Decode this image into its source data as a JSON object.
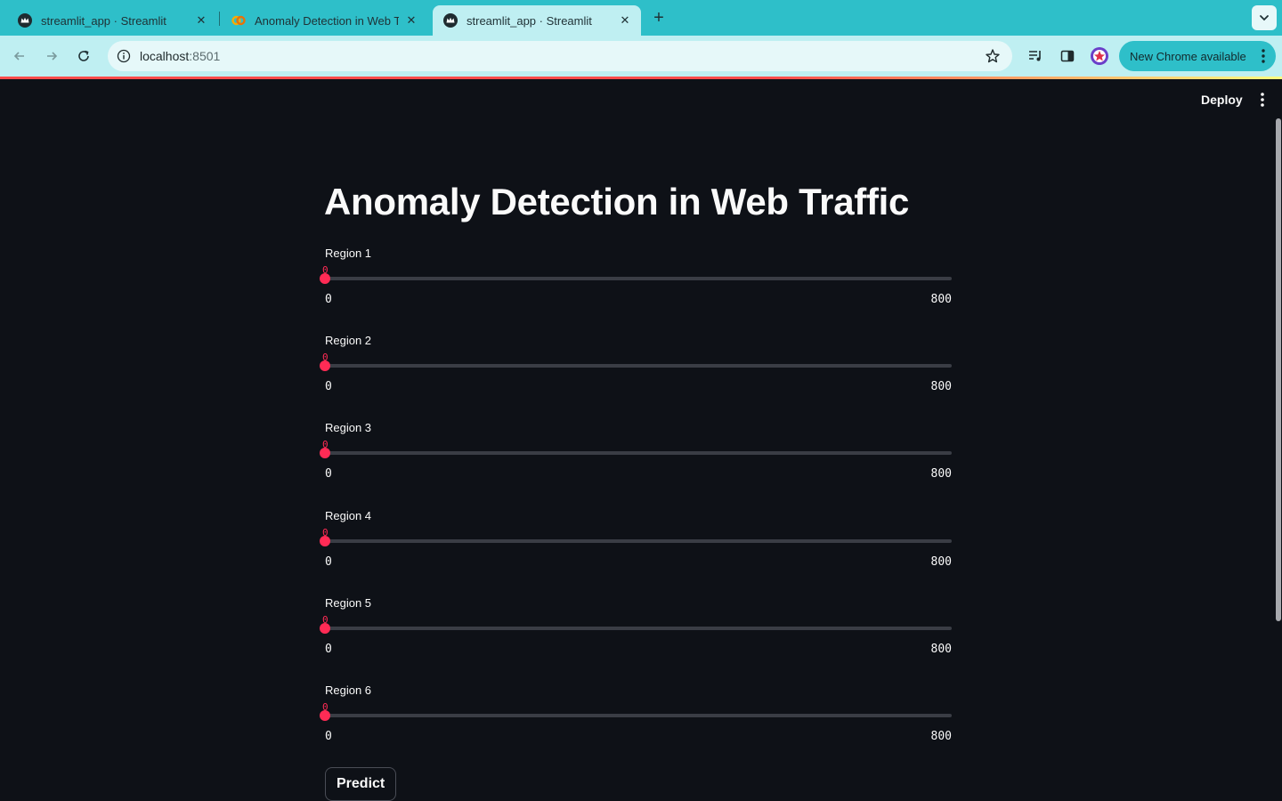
{
  "browser": {
    "tabs": [
      {
        "title": "streamlit_app · Streamlit",
        "icon": "streamlit-crown-icon",
        "active": false
      },
      {
        "title": "Anomaly Detection in Web Tr...",
        "icon": "colab-icon",
        "active": false
      },
      {
        "title": "streamlit_app · Streamlit",
        "icon": "streamlit-crown-icon",
        "active": true
      }
    ],
    "address": {
      "host": "localhost",
      "port": ":8501"
    },
    "update_button": "New Chrome available",
    "colors": {
      "tabstrip": "#2ebfc9",
      "toolbar": "#bfeff2"
    }
  },
  "app": {
    "deploy_label": "Deploy",
    "title": "Anomaly Detection in Web Traffic",
    "sliders": [
      {
        "label": "Region 1",
        "value": "0",
        "min": "0",
        "max": "800",
        "fraction": 0
      },
      {
        "label": "Region 2",
        "value": "0",
        "min": "0",
        "max": "800",
        "fraction": 0
      },
      {
        "label": "Region 3",
        "value": "0",
        "min": "0",
        "max": "800",
        "fraction": 0
      },
      {
        "label": "Region 4",
        "value": "0",
        "min": "0",
        "max": "800",
        "fraction": 0
      },
      {
        "label": "Region 5",
        "value": "0",
        "min": "0",
        "max": "800",
        "fraction": 0
      },
      {
        "label": "Region 6",
        "value": "0",
        "min": "0",
        "max": "800",
        "fraction": 0
      }
    ],
    "predict_label": "Predict",
    "colors": {
      "background": "#0e1117",
      "accent": "#ff2b55",
      "text": "#fafafa"
    }
  }
}
